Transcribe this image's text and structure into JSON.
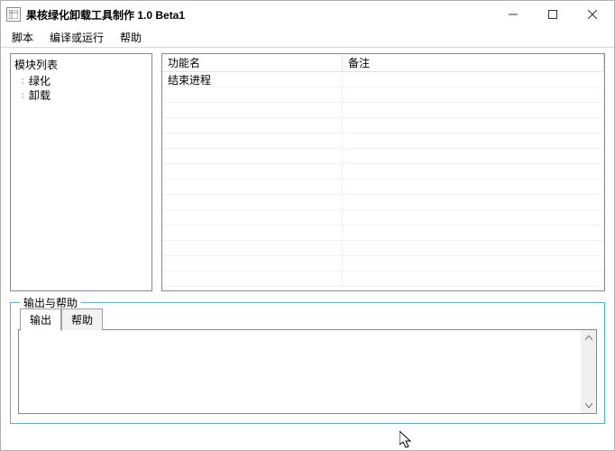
{
  "window": {
    "title": "果核绿化卸载工具制作 1.0 Beta1"
  },
  "menu": {
    "items": [
      "脚本",
      "编译或运行",
      "帮助"
    ]
  },
  "tree": {
    "root": "模块列表",
    "children": [
      "绿化",
      "卸载"
    ]
  },
  "table": {
    "columns": {
      "func": "功能名",
      "remark": "备注"
    },
    "rows": [
      {
        "func": "结束进程",
        "remark": ""
      }
    ]
  },
  "output": {
    "legend": "输出与帮助",
    "tabs": {
      "output": "输出",
      "help": "帮助"
    }
  }
}
